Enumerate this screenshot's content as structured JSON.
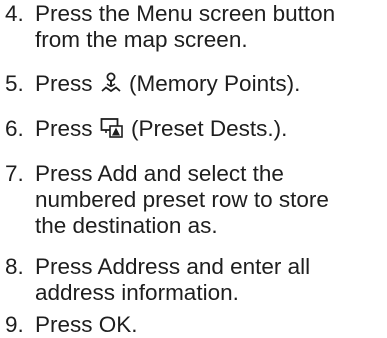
{
  "steps": [
    {
      "number": "4.",
      "lines": [
        "Press the Menu screen button",
        "from the map screen."
      ]
    },
    {
      "number": "5.",
      "prefix": "Press",
      "icon": "memory-points-icon",
      "suffix": "(Memory Points)."
    },
    {
      "number": "6.",
      "prefix": "Press",
      "icon": "preset-destinations-icon",
      "suffix": "(Preset Dests.)."
    },
    {
      "number": "7.",
      "lines": [
        "Press Add and select the",
        "numbered preset row to store",
        "the destination as."
      ]
    },
    {
      "number": "8.",
      "lines": [
        "Press Address and enter all",
        "address information."
      ]
    },
    {
      "number": "9.",
      "lines": [
        "Press OK."
      ]
    }
  ]
}
